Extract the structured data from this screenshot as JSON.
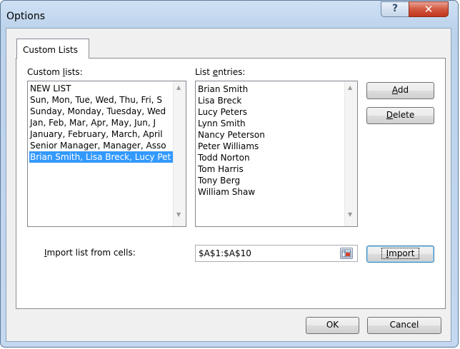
{
  "window": {
    "title": "Options",
    "help_glyph": "?",
    "close_glyph": "✕"
  },
  "tabs": [
    {
      "label": "Custom Lists",
      "active": true
    }
  ],
  "custom_lists": {
    "label_before": "Custom ",
    "label_access": "l",
    "label_after": "ists:",
    "items": [
      "NEW LIST",
      "Sun, Mon, Tue, Wed, Thu, Fri, S",
      "Sunday, Monday, Tuesday, Wed",
      "Jan, Feb, Mar, Apr, May, Jun, J",
      "January, February, March, April",
      "Senior Manager, Manager, Asso",
      "Brian Smith, Lisa Breck, Lucy Pet"
    ],
    "selected_index": 6
  },
  "list_entries": {
    "label_before": "List ",
    "label_access": "e",
    "label_after": "ntries:",
    "items": [
      "Brian Smith",
      "Lisa Breck",
      "Lucy Peters",
      "Lynn Smith",
      "Nancy Peterson",
      "Peter Williams",
      "Todd Norton",
      "Tom Harris",
      "Tony Berg",
      "William Shaw"
    ]
  },
  "buttons": {
    "add": {
      "access": "A",
      "rest": "dd"
    },
    "delete": {
      "access": "D",
      "rest": "elete"
    },
    "import": {
      "access": "I",
      "rest": "mport"
    },
    "ok": "OK",
    "cancel": "Cancel"
  },
  "import_range": {
    "label_access": "I",
    "label_rest": "mport list from cells:",
    "value": "$A$1:$A$10",
    "icon": "range-select-icon"
  },
  "colors": {
    "selection": "#3399ff",
    "close_button": "#c7432a"
  }
}
